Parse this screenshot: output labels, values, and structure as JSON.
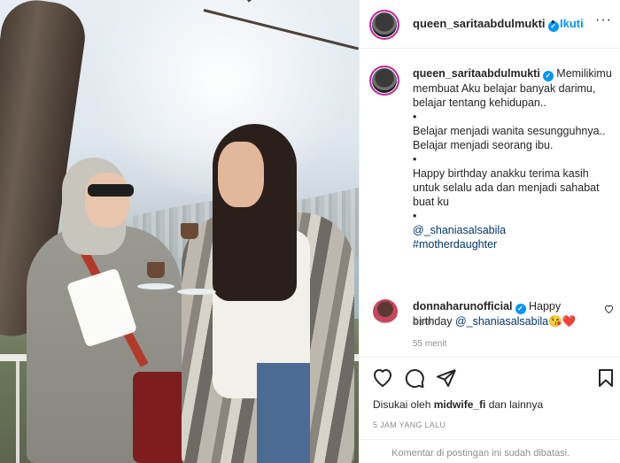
{
  "post": {
    "username": "queen_saritaabdulmukti",
    "verified_mark": "✓",
    "separator": "•",
    "follow_label": "Ikuti",
    "more_label": "···"
  },
  "caption": {
    "username": "queen_saritaabdulmukti",
    "line_1": "Memilikimu membuat Aku belajar banyak darimu, belajar tentang kehidupan..",
    "bullet": "•",
    "line_2": "Belajar menjadi wanita sesungguhnya..",
    "line_3": "Belajar menjadi seorang ibu.",
    "line_4": "Happy birthday anakku terima kasih untuk selalu ada dan menjadi sahabat buat ku",
    "mention": "@_shaniasalsabila",
    "hashtag": "#motherdaughter",
    "time": "4 jam"
  },
  "comment": {
    "username": "donnaharunofficial",
    "text_prefix": "Happy birthday",
    "mention": "@_shaniasalsabila",
    "emojis": "😘❤️",
    "time": "55 menit"
  },
  "likes": {
    "prefix": "Disukai oleh",
    "user": "midwife_fi",
    "suffix": "dan lainnya"
  },
  "post_date": "5 JAM YANG LALU",
  "footer_text": "Komentar di postingan ini sudah dibatasi.",
  "icons": {
    "heart": "heart-icon",
    "comment": "comment-icon",
    "share": "share-icon",
    "save": "bookmark-icon"
  },
  "colors": {
    "accent": "#0095f6",
    "link": "#00376b",
    "muted": "#8e8e8e",
    "story_ring": "#c32aa3"
  }
}
